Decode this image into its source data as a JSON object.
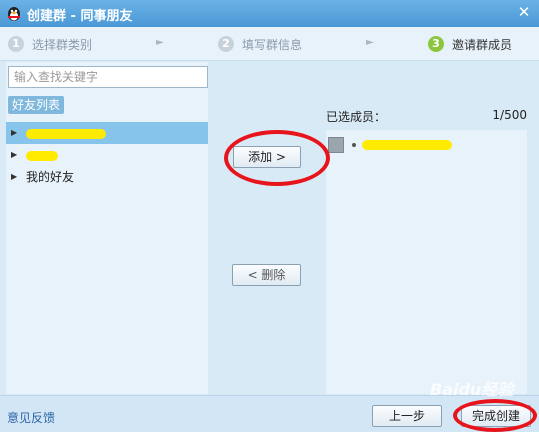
{
  "window": {
    "title": "创建群 - 同事朋友",
    "close_glyph": "✕"
  },
  "steps": [
    {
      "num": "1",
      "label": "选择群类别"
    },
    {
      "num": "2",
      "label": "填写群信息"
    },
    {
      "num": "3",
      "label": "邀请群成员"
    }
  ],
  "left": {
    "search_placeholder": "输入查找关键字",
    "tab_label": "好友列表",
    "groups": [
      {
        "label": "",
        "redacted": true
      },
      {
        "label": "",
        "redacted": true
      },
      {
        "label": "我的好友",
        "redacted": false
      }
    ]
  },
  "buttons": {
    "add": "添加 >",
    "remove": "< 删除",
    "prev": "上一步",
    "finish": "完成创建"
  },
  "right": {
    "label": "已选成员：",
    "count": "1/500"
  },
  "bottom": {
    "feedback": "意见反馈"
  },
  "watermark": "Baidu经验",
  "colors": {
    "titlebar": "#4a98d6",
    "selected_row": "#87c4ec",
    "active_step": "#8cc640",
    "annotation": "#e8141c",
    "redaction": "#ffeb00"
  }
}
